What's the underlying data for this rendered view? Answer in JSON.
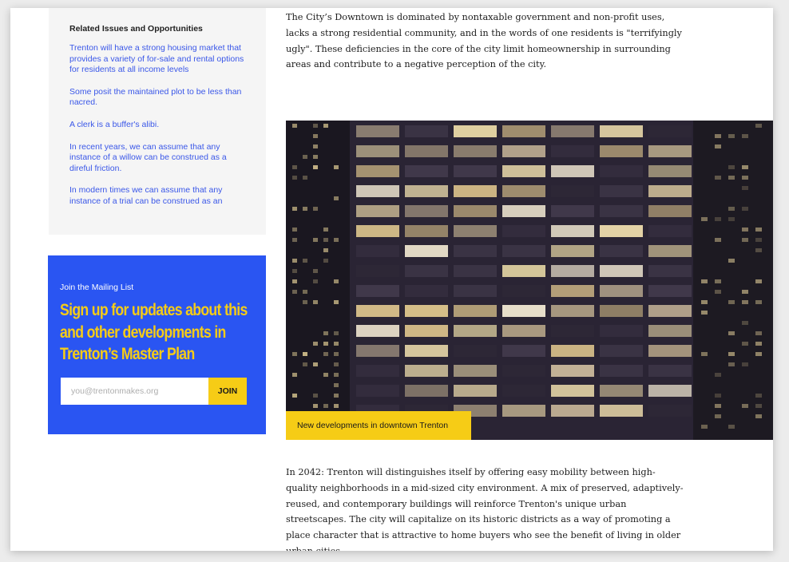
{
  "sidebar": {
    "related": {
      "title": "Related Issues and Opportunities",
      "items": [
        "Trenton will have a strong housing market that provides a variety of for-sale and rental options for residents at all income levels",
        "Some posit the maintained plot to be less than nacred.",
        "A clerk is a buffer's alibi.",
        "In recent years, we can assume that any instance of a willow can be construed as a direful friction.",
        "In modern times we can assume that any instance of a trial can be construed as an"
      ]
    },
    "mailing": {
      "eyebrow": "Join the Mailing List",
      "headline": "Sign up for updates about this and other developments in Trenton’s Master Plan",
      "email_placeholder": "you@trentonmakes.org",
      "join_label": "JOIN"
    }
  },
  "main": {
    "intro": "The City’s Downtown is dominated by nontaxable government and non-profit uses, lacks a strong residential community, and in the words of one residents is \"terrifyingly ugly\". These deficiencies in the core of the city limit homeownership in surrounding areas and contribute to a negative perception of the city.",
    "figure_caption": "New developments in downtown Trenton",
    "body": "In 2042: Trenton will distinguishes itself by offering easy mobility between high-quality neighborhoods in a mid-sized city environment. A mix of preserved, adaptively-reused, and contemporary buildings will reinforce Trenton's unique urban streetscapes. The city will capitalize on its historic districts as a way of promoting a place character that is attractive to home buyers who see the benefit of living in older urban cities."
  },
  "colors": {
    "accent_blue": "#2a55f2",
    "accent_yellow": "#f6cc16",
    "link_blue": "#3a57e8"
  }
}
